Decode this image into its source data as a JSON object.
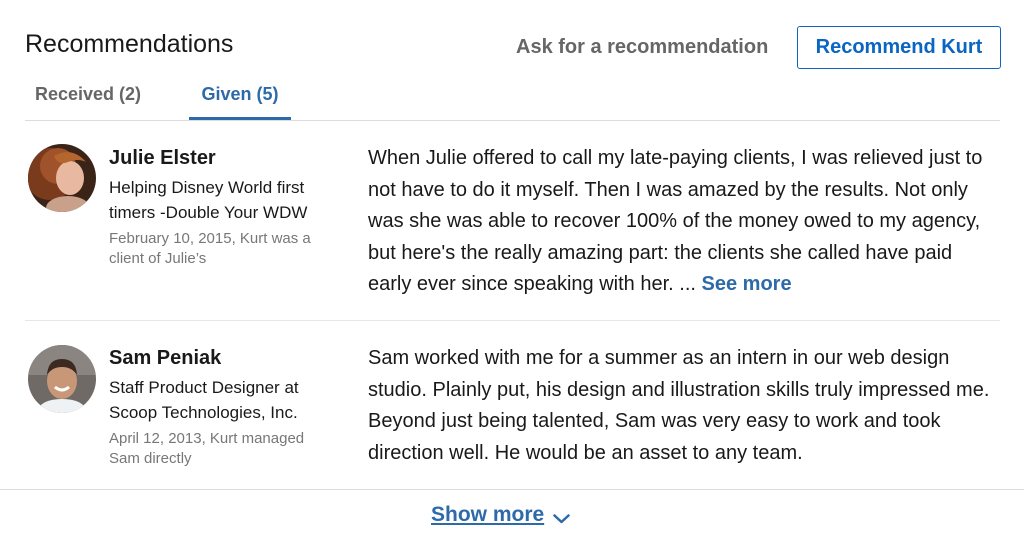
{
  "header": {
    "title": "Recommendations",
    "ask_link": "Ask for a recommendation",
    "recommend_button": "Recommend Kurt"
  },
  "tabs": [
    {
      "label": "Received (2)",
      "active": false
    },
    {
      "label": "Given (5)",
      "active": true
    }
  ],
  "recommendations": [
    {
      "name": "Julie Elster",
      "headline": "Helping Disney World first timers -Double Your WDW",
      "meta": "February 10, 2015, Kurt was a client of Julie’s",
      "text": "When Julie offered to call my late-paying clients, I was relieved just to not have to do it myself. Then I was amazed by the results. Not only was she was able to recover 100% of the money owed to my agency, but here's the really amazing part: the clients she called have paid early ever since speaking with her. ...",
      "see_more": "See more"
    },
    {
      "name": "Sam Peniak",
      "headline": "Staff Product Designer at Scoop Technologies, Inc.",
      "meta": "April 12, 2013, Kurt managed Sam directly",
      "text": "Sam worked with me for a summer as an intern in our web design studio. Plainly put, his design and illustration skills truly impressed me. Beyond just being talented, Sam was very easy to work and took direction well. He would be an asset to any team."
    }
  ],
  "footer": {
    "show_more": "Show more",
    "chevron_icon": "chevron-down-icon"
  },
  "colors": {
    "accent": "#0a66c2",
    "link": "#2e6aa8",
    "muted": "#666666"
  }
}
